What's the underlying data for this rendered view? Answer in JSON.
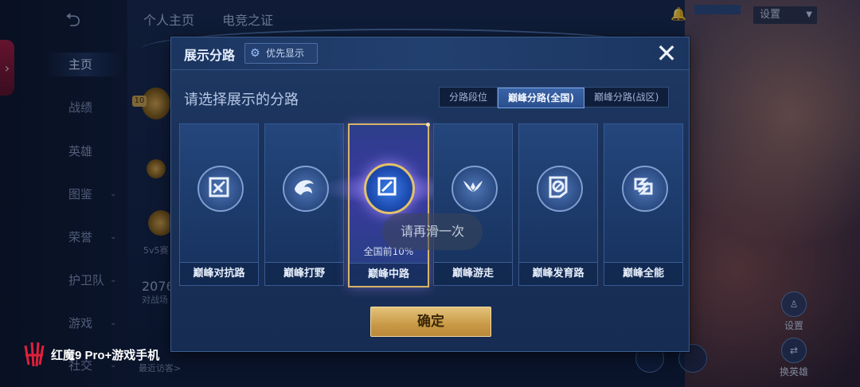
{
  "background": {
    "top_tabs": [
      "个人主页",
      "电竞之证"
    ],
    "settings_label": "设置",
    "nav_items": [
      {
        "label": "主页",
        "has_chevron": false,
        "active": true
      },
      {
        "label": "战绩",
        "has_chevron": false,
        "active": false
      },
      {
        "label": "英雄",
        "has_chevron": false,
        "active": false
      },
      {
        "label": "图鉴",
        "has_chevron": true,
        "active": false
      },
      {
        "label": "荣誉",
        "has_chevron": true,
        "active": false
      },
      {
        "label": "护卫队",
        "has_chevron": true,
        "active": false
      },
      {
        "label": "游戏",
        "has_chevron": true,
        "active": false
      },
      {
        "label": "社交",
        "has_chevron": true,
        "active": false
      }
    ],
    "level_badge": "10",
    "mode_text": "5v5赛",
    "stat_number": "2076",
    "stat_sub": "对战场",
    "recent_visitors": "最近访客>",
    "right_buttons": [
      "设置",
      "换英雄"
    ]
  },
  "dialog": {
    "title": "展示分路",
    "priority_button": "优先显示",
    "prompt": "请选择展示的分路",
    "segment_options": [
      "分路段位",
      "巅峰分路(全国)",
      "巅峰分路(战区)"
    ],
    "selected_segment": 1,
    "roles": [
      {
        "label": "巅峰对抗路",
        "icon": "sword-cross-icon",
        "percent": ""
      },
      {
        "label": "巅峰打野",
        "icon": "dragon-icon",
        "percent": ""
      },
      {
        "label": "巅峰中路",
        "icon": "mid-lane-icon",
        "percent": "全国前10%",
        "selected": true
      },
      {
        "label": "巅峰游走",
        "icon": "wings-icon",
        "percent": ""
      },
      {
        "label": "巅峰发育路",
        "icon": "target-icon",
        "percent": ""
      },
      {
        "label": "巅峰全能",
        "icon": "allround-icon",
        "percent": ""
      }
    ],
    "confirm_label": "确定"
  },
  "toast": "请再滑一次",
  "watermark": "红魔9 Pro+游戏手机",
  "colors": {
    "accent_gold": "#d6b468",
    "selected_segment": "#2a4f8e",
    "dialog_bg": "#1a3159"
  }
}
